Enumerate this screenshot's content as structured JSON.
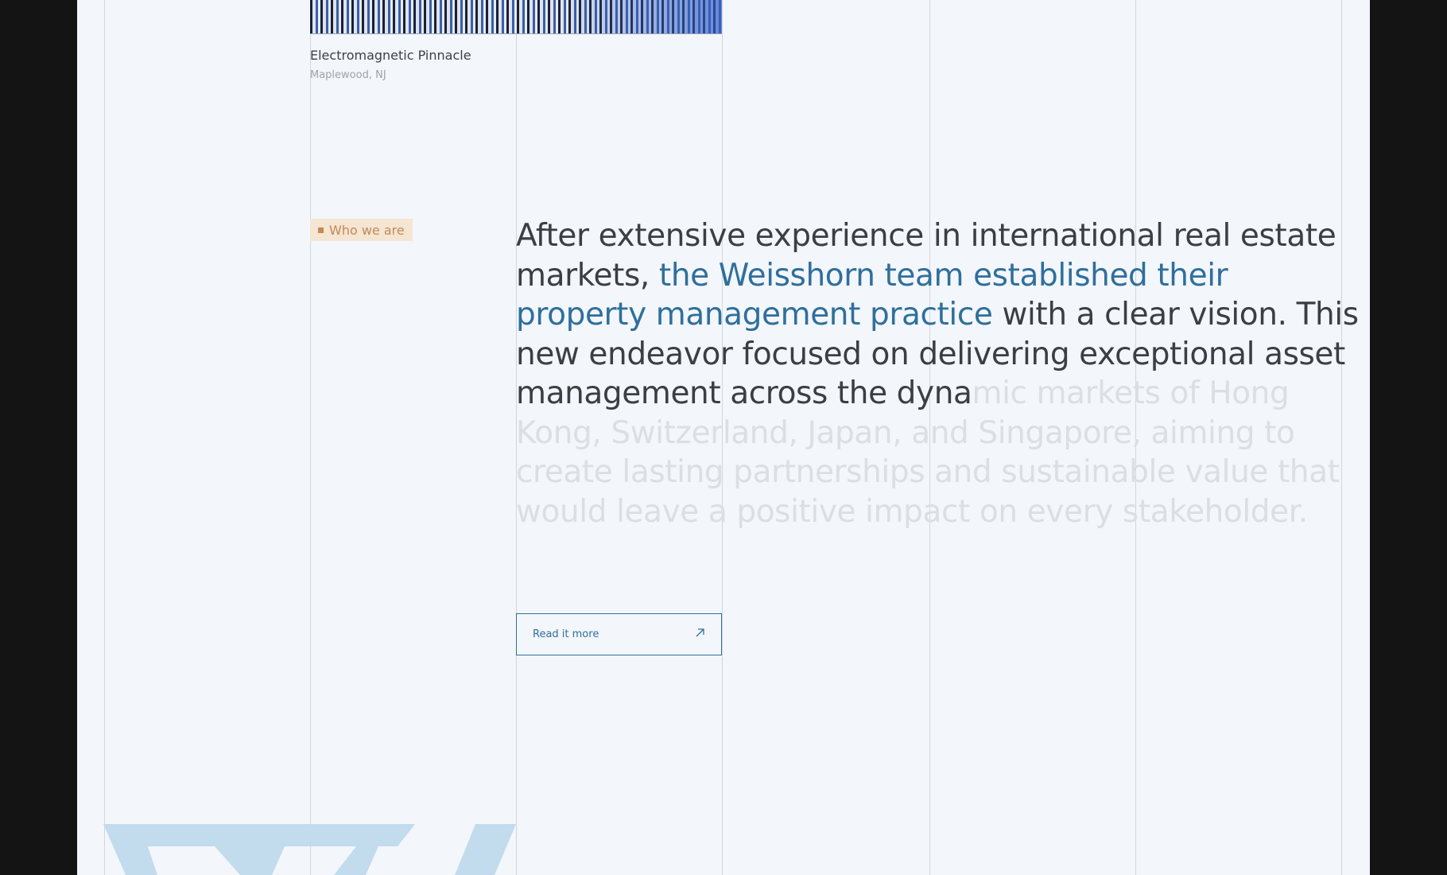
{
  "project": {
    "title": "Electromagnetic Pinnacle",
    "location": "Maplewood, NJ"
  },
  "section_tag": "Who we are",
  "statement": {
    "part1": "After extensive experience in international real estate markets, ",
    "highlight": "the Weisshorn team established their property management practice",
    "part2": " with a clear vision. This new endeavor focused on delivering exceptional asset management across the dyna",
    "faded": "mic markets of Hong Kong, Switzerland, Japan, and Singapore, aiming to create lasting partnerships and sustainable value that would leave a positive impact on every stakeholder."
  },
  "cta": {
    "label": "Read it more",
    "icon": "arrow-up-right-icon"
  },
  "colors": {
    "accent": "#2f6f9b",
    "tag_text": "#c38a55",
    "tag_bg": "#f5e5d3",
    "page_bg": "#f3f6fb",
    "logo": "#c2dbed"
  }
}
